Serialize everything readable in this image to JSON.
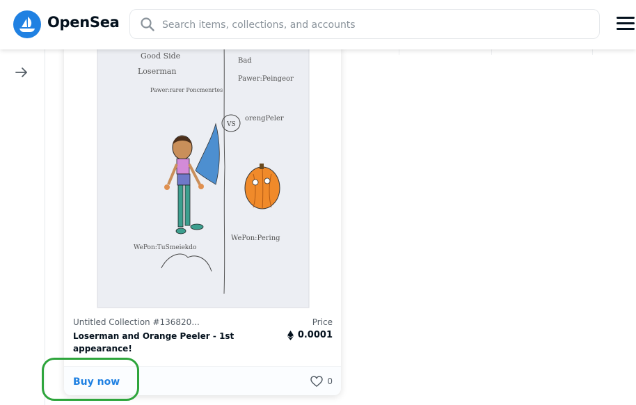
{
  "header": {
    "logo_text": "OpenSea",
    "search_placeholder": "Search items, collections, and accounts"
  },
  "card": {
    "collection": "Untitled Collection #136820...",
    "name": "Loserman and Orange Peeler - 1st appearance!",
    "price_label": "Price",
    "price": "0.0001",
    "buy_label": "Buy now",
    "likes": "0"
  },
  "drawing_texts": {
    "good_side": "Good Side",
    "loserman": "Loserman",
    "powers_left": "Pawer:rarer Poncmenrtes",
    "bad_side": "Bad",
    "powers_right": "Pawer:Peingeor",
    "vs": "VS",
    "orange_peeler": "orengPeler",
    "weapon_left": "WePon:TuSmeiekdo",
    "weapon_right": "WePon:Pering"
  },
  "colors": {
    "accent": "#2081e2",
    "highlight": "#2ea53c"
  }
}
